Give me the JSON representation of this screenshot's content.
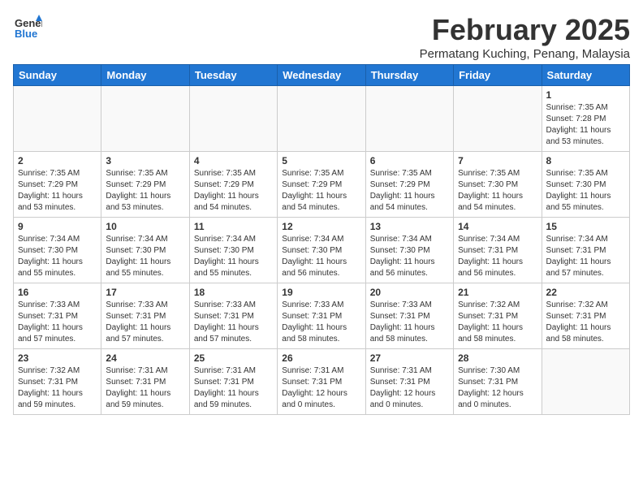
{
  "header": {
    "logo_line1": "General",
    "logo_line2": "Blue",
    "month_title": "February 2025",
    "subtitle": "Permatang Kuching, Penang, Malaysia"
  },
  "weekdays": [
    "Sunday",
    "Monday",
    "Tuesday",
    "Wednesday",
    "Thursday",
    "Friday",
    "Saturday"
  ],
  "weeks": [
    [
      {
        "day": "",
        "info": ""
      },
      {
        "day": "",
        "info": ""
      },
      {
        "day": "",
        "info": ""
      },
      {
        "day": "",
        "info": ""
      },
      {
        "day": "",
        "info": ""
      },
      {
        "day": "",
        "info": ""
      },
      {
        "day": "1",
        "info": "Sunrise: 7:35 AM\nSunset: 7:28 PM\nDaylight: 11 hours\nand 53 minutes."
      }
    ],
    [
      {
        "day": "2",
        "info": "Sunrise: 7:35 AM\nSunset: 7:29 PM\nDaylight: 11 hours\nand 53 minutes."
      },
      {
        "day": "3",
        "info": "Sunrise: 7:35 AM\nSunset: 7:29 PM\nDaylight: 11 hours\nand 53 minutes."
      },
      {
        "day": "4",
        "info": "Sunrise: 7:35 AM\nSunset: 7:29 PM\nDaylight: 11 hours\nand 54 minutes."
      },
      {
        "day": "5",
        "info": "Sunrise: 7:35 AM\nSunset: 7:29 PM\nDaylight: 11 hours\nand 54 minutes."
      },
      {
        "day": "6",
        "info": "Sunrise: 7:35 AM\nSunset: 7:29 PM\nDaylight: 11 hours\nand 54 minutes."
      },
      {
        "day": "7",
        "info": "Sunrise: 7:35 AM\nSunset: 7:30 PM\nDaylight: 11 hours\nand 54 minutes."
      },
      {
        "day": "8",
        "info": "Sunrise: 7:35 AM\nSunset: 7:30 PM\nDaylight: 11 hours\nand 55 minutes."
      }
    ],
    [
      {
        "day": "9",
        "info": "Sunrise: 7:34 AM\nSunset: 7:30 PM\nDaylight: 11 hours\nand 55 minutes."
      },
      {
        "day": "10",
        "info": "Sunrise: 7:34 AM\nSunset: 7:30 PM\nDaylight: 11 hours\nand 55 minutes."
      },
      {
        "day": "11",
        "info": "Sunrise: 7:34 AM\nSunset: 7:30 PM\nDaylight: 11 hours\nand 55 minutes."
      },
      {
        "day": "12",
        "info": "Sunrise: 7:34 AM\nSunset: 7:30 PM\nDaylight: 11 hours\nand 56 minutes."
      },
      {
        "day": "13",
        "info": "Sunrise: 7:34 AM\nSunset: 7:30 PM\nDaylight: 11 hours\nand 56 minutes."
      },
      {
        "day": "14",
        "info": "Sunrise: 7:34 AM\nSunset: 7:31 PM\nDaylight: 11 hours\nand 56 minutes."
      },
      {
        "day": "15",
        "info": "Sunrise: 7:34 AM\nSunset: 7:31 PM\nDaylight: 11 hours\nand 57 minutes."
      }
    ],
    [
      {
        "day": "16",
        "info": "Sunrise: 7:33 AM\nSunset: 7:31 PM\nDaylight: 11 hours\nand 57 minutes."
      },
      {
        "day": "17",
        "info": "Sunrise: 7:33 AM\nSunset: 7:31 PM\nDaylight: 11 hours\nand 57 minutes."
      },
      {
        "day": "18",
        "info": "Sunrise: 7:33 AM\nSunset: 7:31 PM\nDaylight: 11 hours\nand 57 minutes."
      },
      {
        "day": "19",
        "info": "Sunrise: 7:33 AM\nSunset: 7:31 PM\nDaylight: 11 hours\nand 58 minutes."
      },
      {
        "day": "20",
        "info": "Sunrise: 7:33 AM\nSunset: 7:31 PM\nDaylight: 11 hours\nand 58 minutes."
      },
      {
        "day": "21",
        "info": "Sunrise: 7:32 AM\nSunset: 7:31 PM\nDaylight: 11 hours\nand 58 minutes."
      },
      {
        "day": "22",
        "info": "Sunrise: 7:32 AM\nSunset: 7:31 PM\nDaylight: 11 hours\nand 58 minutes."
      }
    ],
    [
      {
        "day": "23",
        "info": "Sunrise: 7:32 AM\nSunset: 7:31 PM\nDaylight: 11 hours\nand 59 minutes."
      },
      {
        "day": "24",
        "info": "Sunrise: 7:31 AM\nSunset: 7:31 PM\nDaylight: 11 hours\nand 59 minutes."
      },
      {
        "day": "25",
        "info": "Sunrise: 7:31 AM\nSunset: 7:31 PM\nDaylight: 11 hours\nand 59 minutes."
      },
      {
        "day": "26",
        "info": "Sunrise: 7:31 AM\nSunset: 7:31 PM\nDaylight: 12 hours\nand 0 minutes."
      },
      {
        "day": "27",
        "info": "Sunrise: 7:31 AM\nSunset: 7:31 PM\nDaylight: 12 hours\nand 0 minutes."
      },
      {
        "day": "28",
        "info": "Sunrise: 7:30 AM\nSunset: 7:31 PM\nDaylight: 12 hours\nand 0 minutes."
      },
      {
        "day": "",
        "info": ""
      }
    ]
  ]
}
